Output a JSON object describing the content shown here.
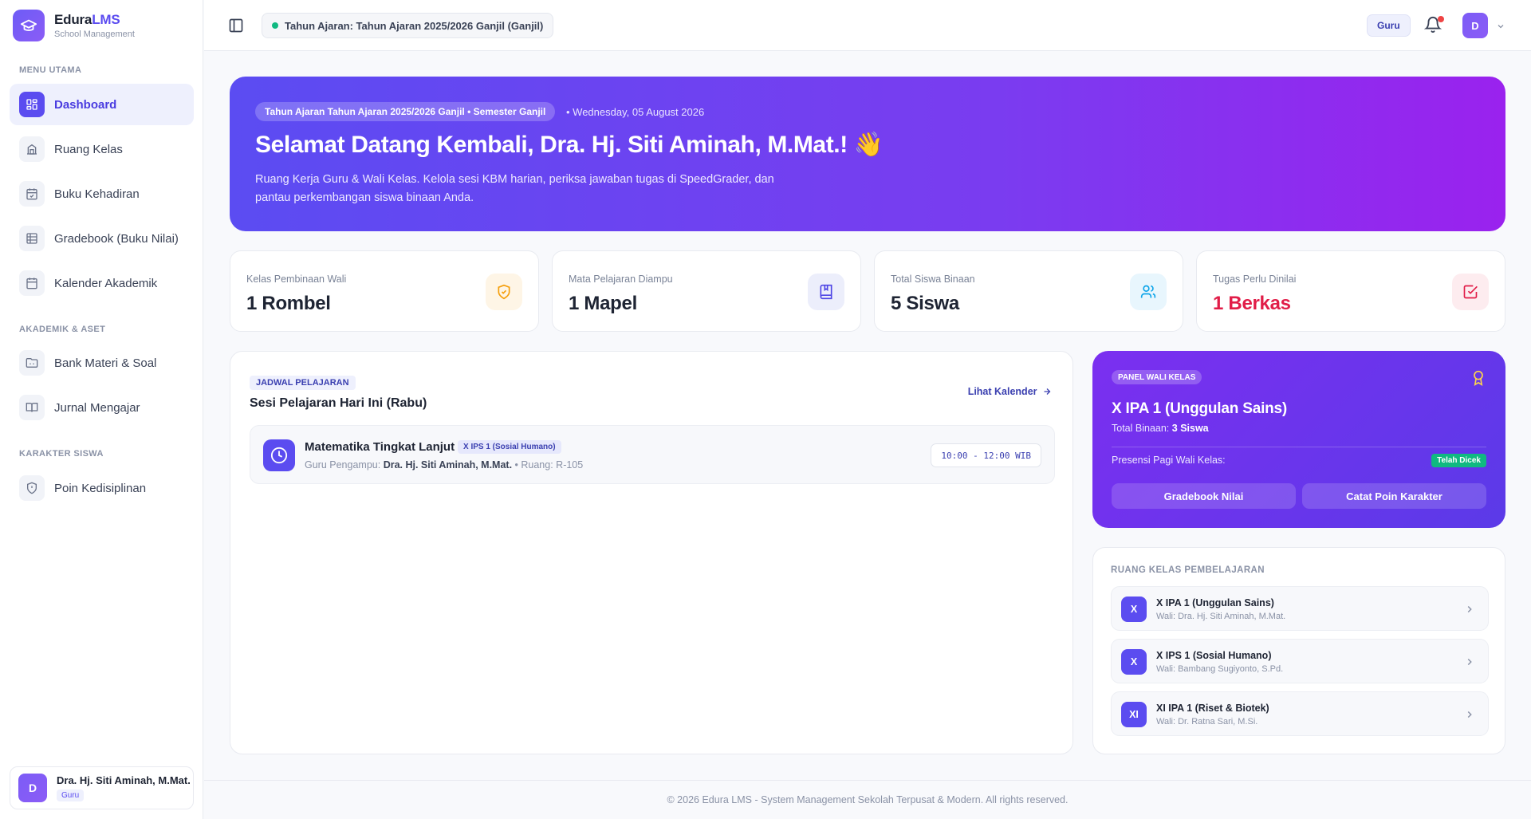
{
  "brand": {
    "name_main": "Edura",
    "name_accent": "LMS",
    "subtitle": "School Management"
  },
  "sidebar": {
    "sections": [
      {
        "label": "MENU UTAMA"
      },
      {
        "label": "AKADEMIK & ASET"
      },
      {
        "label": "KARAKTER SISWA"
      }
    ],
    "items": [
      {
        "label": "Dashboard",
        "icon": "dashboard-icon",
        "active": true
      },
      {
        "label": "Ruang Kelas",
        "icon": "classroom-icon"
      },
      {
        "label": "Buku Kehadiran",
        "icon": "attendance-icon"
      },
      {
        "label": "Gradebook (Buku Nilai)",
        "icon": "table-icon"
      },
      {
        "label": "Kalender Akademik",
        "icon": "calendar-icon"
      },
      {
        "label": "Bank Materi & Soal",
        "icon": "folder-icon"
      },
      {
        "label": "Jurnal Mengajar",
        "icon": "book-icon"
      },
      {
        "label": "Poin Kedisiplinan",
        "icon": "shield-icon"
      }
    ],
    "user": {
      "initial": "D",
      "name": "Dra. Hj. Siti Aminah, M.Mat.",
      "role": "Guru"
    }
  },
  "topbar": {
    "year_label": "Tahun Ajaran: Tahun Ajaran 2025/2026 Ganjil (Ganjil)",
    "role": "Guru",
    "avatar_initial": "D"
  },
  "hero": {
    "pill": "Tahun Ajaran Tahun Ajaran 2025/2026 Ganjil • Semester Ganjil",
    "date": "• Wednesday, 05 August 2026",
    "title": "Selamat Datang Kembali, Dra. Hj. Siti Aminah, M.Mat.!",
    "emoji": "👋",
    "description": "Ruang Kerja Guru & Wali Kelas. Kelola sesi KBM harian, periksa jawaban tugas di SpeedGrader, dan pantau perkembangan siswa binaan Anda."
  },
  "stats": [
    {
      "label": "Kelas Pembinaan Wali",
      "value": "1 Rombel",
      "icon": "shield-check-icon",
      "color": "#f59e0b"
    },
    {
      "label": "Mata Pelajaran Diampu",
      "value": "1 Mapel",
      "icon": "bookmark-book-icon",
      "color": "#4f46e5"
    },
    {
      "label": "Total Siswa Binaan",
      "value": "5 Siswa",
      "icon": "users-icon",
      "color": "#0ea5e9"
    },
    {
      "label": "Tugas Perlu Dinilai",
      "value": "1 Berkas",
      "icon": "check-square-icon",
      "color": "#e11d48"
    }
  ],
  "schedule": {
    "tag": "JADWAL PELAJARAN",
    "title": "Sesi Pelajaran Hari Ini (Rabu)",
    "link": "Lihat Kalender",
    "lesson": {
      "subject": "Matematika Tingkat Lanjut",
      "class": "X IPS 1 (Sosial Humano)",
      "teacher_prefix": "Guru Pengampu:",
      "teacher": "Dra. Hj. Siti Aminah, M.Mat.",
      "room": "• Ruang: R-105",
      "time": "10:00 - 12:00 WIB"
    }
  },
  "wali_panel": {
    "tag": "PANEL WALI KELAS",
    "class_name": "X IPA 1 (Unggulan Sains)",
    "total_prefix": "Total Binaan:",
    "total_value": "3 Siswa",
    "presensi_label": "Presensi Pagi Wali Kelas:",
    "presensi_status": "Telah Dicek",
    "btn_gradebook": "Gradebook Nilai",
    "btn_poin": "Catat Poin Karakter"
  },
  "classrooms": {
    "title": "RUANG KELAS PEMBELAJARAN",
    "items": [
      {
        "badge": "X",
        "name": "X IPA 1 (Unggulan Sains)",
        "wali": "Wali: Dra. Hj. Siti Aminah, M.Mat."
      },
      {
        "badge": "X",
        "name": "X IPS 1 (Sosial Humano)",
        "wali": "Wali: Bambang Sugiyonto, S.Pd."
      },
      {
        "badge": "XI",
        "name": "XI IPA 1 (Riset & Biotek)",
        "wali": "Wali: Dr. Ratna Sari, M.Si."
      }
    ]
  },
  "footer": "© 2026 Edura LMS - System Management Sekolah Terpusat & Modern. All rights reserved."
}
